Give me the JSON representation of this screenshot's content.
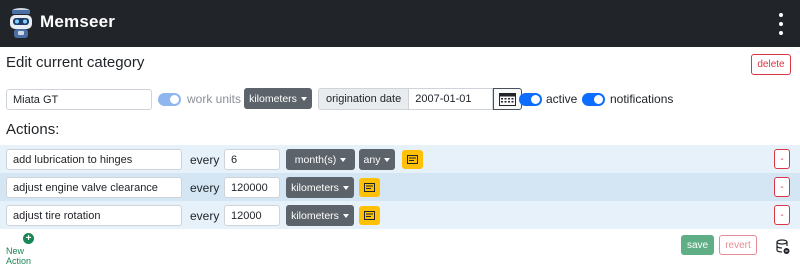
{
  "app": {
    "brand": "Memseer",
    "menu_icon": "kebab-menu-icon",
    "logo_icon": "robot-logo-icon"
  },
  "category": {
    "heading": "Edit current category",
    "delete_label": "delete",
    "name_value": "Miata GT",
    "work_units_label": "work units",
    "work_units_enabled": true,
    "units_value": "kilometers",
    "origination_label": "origination date",
    "origination_value": "2007-01-01",
    "active_label": "active",
    "active_enabled": true,
    "notifications_label": "notifications",
    "notifications_enabled": true
  },
  "actions": {
    "heading": "Actions:",
    "every_label": "every",
    "remove_label": "-",
    "rows": [
      {
        "name": "add lubrication to hinges",
        "interval": "6",
        "unit": "month(s)",
        "modifier": "any"
      },
      {
        "name": "adjust engine valve clearance",
        "interval": "120000",
        "unit": "kilometers"
      },
      {
        "name": "adjust tire rotation",
        "interval": "12000",
        "unit": "kilometers"
      }
    ]
  },
  "footer": {
    "new_action_label": "New Action",
    "save_label": "save",
    "revert_label": "revert"
  },
  "colors": {
    "navbar": "#212529",
    "primary": "#0d6efd",
    "danger": "#dc3545",
    "warning": "#ffc107",
    "success": "#198754",
    "secondary": "#5c636a"
  }
}
